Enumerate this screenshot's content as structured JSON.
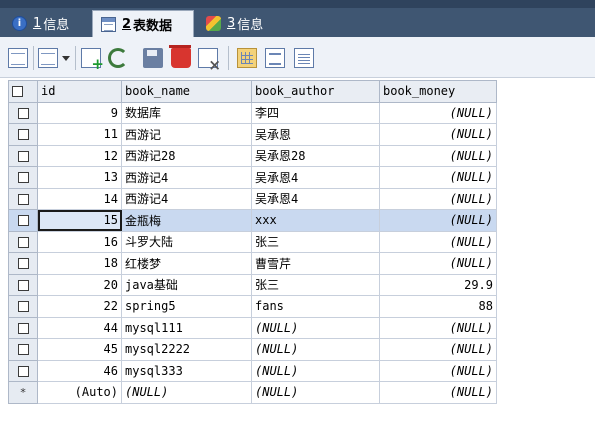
{
  "tabs": [
    {
      "num": "1",
      "label": "信息",
      "icon": "info-icon"
    },
    {
      "num": "2",
      "label": "表数据",
      "icon": "table-icon"
    },
    {
      "num": "3",
      "label": "信息",
      "icon": "puzzle-icon"
    }
  ],
  "grid": {
    "columns": [
      "id",
      "book_name",
      "book_author",
      "book_money"
    ],
    "rows": [
      {
        "id": "9",
        "book_name": "数据库",
        "book_author": "李四",
        "book_money": "(NULL)"
      },
      {
        "id": "11",
        "book_name": "西游记",
        "book_author": "吴承恩",
        "book_money": "(NULL)"
      },
      {
        "id": "12",
        "book_name": "西游记28",
        "book_author": "吴承恩28",
        "book_money": "(NULL)"
      },
      {
        "id": "13",
        "book_name": "西游记4",
        "book_author": "吴承恩4",
        "book_money": "(NULL)"
      },
      {
        "id": "14",
        "book_name": "西游记4",
        "book_author": "吴承恩4",
        "book_money": "(NULL)"
      },
      {
        "id": "15",
        "book_name": "金瓶梅",
        "book_author": "xxx",
        "book_money": "(NULL)"
      },
      {
        "id": "16",
        "book_name": "斗罗大陆",
        "book_author": "张三",
        "book_money": "(NULL)"
      },
      {
        "id": "18",
        "book_name": "红楼梦",
        "book_author": "曹雪芹",
        "book_money": "(NULL)"
      },
      {
        "id": "20",
        "book_name": "java基础",
        "book_author": "张三",
        "book_money": "29.9"
      },
      {
        "id": "22",
        "book_name": "spring5",
        "book_author": "fans",
        "book_money": "88"
      },
      {
        "id": "44",
        "book_name": "mysql111",
        "book_author": "(NULL)",
        "book_money": "(NULL)"
      },
      {
        "id": "45",
        "book_name": "mysql2222",
        "book_author": "(NULL)",
        "book_money": "(NULL)"
      },
      {
        "id": "46",
        "book_name": "mysql333",
        "book_author": "(NULL)",
        "book_money": "(NULL)"
      }
    ],
    "new_row": {
      "marker": "*",
      "id": "(Auto)",
      "book_name": "(NULL)",
      "book_author": "(NULL)",
      "book_money": "(NULL)"
    },
    "current_row_id": "15"
  },
  "colors": {
    "tabbar_bg": "#3f5672",
    "selected_row_bg": "#c9d9f0"
  }
}
